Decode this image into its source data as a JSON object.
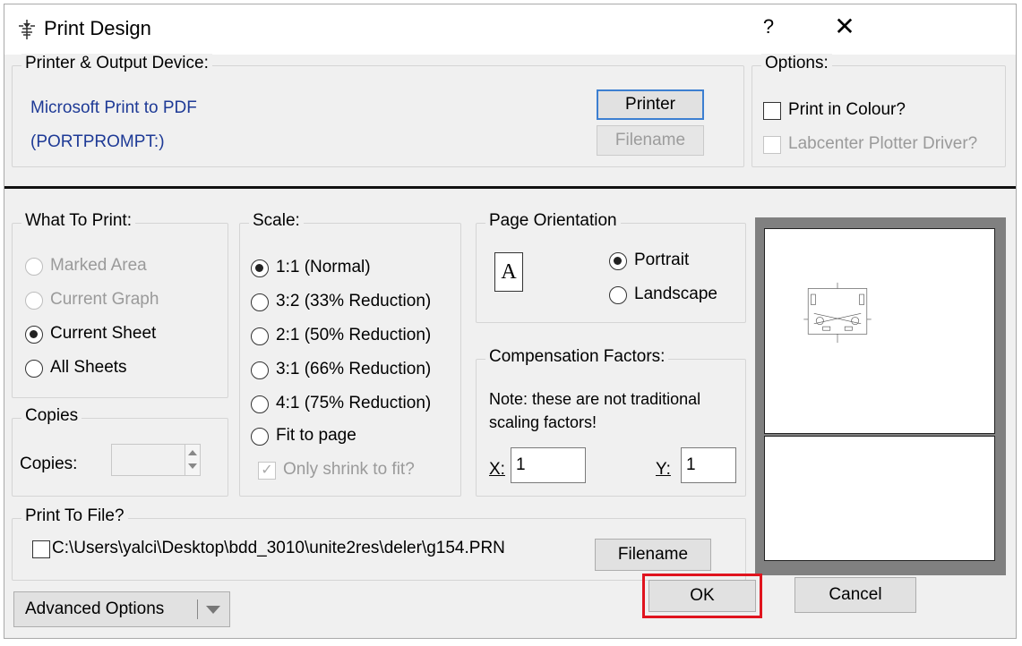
{
  "window": {
    "title": "Print Design",
    "help": "?",
    "close": "✕"
  },
  "printer": {
    "legend": "Printer & Output Device:",
    "device": "Microsoft Print to PDF",
    "port": "(PORTPROMPT:)",
    "printer_btn": "Printer",
    "filename_btn": "Filename"
  },
  "options": {
    "legend": "Options:",
    "print_colour": "Print in Colour?",
    "plotter_driver": "Labcenter Plotter Driver?"
  },
  "what_to_print": {
    "legend": "What To Print:",
    "items": [
      "Marked Area",
      "Current Graph",
      "Current Sheet",
      "All Sheets"
    ],
    "selected": "Current Sheet"
  },
  "scale": {
    "legend": "Scale:",
    "items": [
      "1:1 (Normal)",
      "3:2 (33% Reduction)",
      "2:1 (50% Reduction)",
      "3:1 (66% Reduction)",
      "4:1 (75% Reduction)",
      "Fit to page"
    ],
    "selected": "1:1 (Normal)",
    "shrink_label": "Only shrink to fit?"
  },
  "orientation": {
    "legend": "Page Orientation",
    "portrait": "Portrait",
    "landscape": "Landscape",
    "selected": "Portrait",
    "page_glyph": "A"
  },
  "compensation": {
    "legend": "Compensation Factors:",
    "note_line1": "Note: these are not traditional",
    "note_line2": "scaling factors!",
    "x_label": "X:",
    "x_value": "1",
    "y_label": "Y:",
    "y_value": "1"
  },
  "copies": {
    "legend": "Copies",
    "label": "Copies:",
    "value": ""
  },
  "print_to_file": {
    "legend": "Print To File?",
    "path": "C:\\Users\\yalci\\Desktop\\bdd_3010\\unite2res\\deler\\g154.PRN",
    "filename_btn": "Filename"
  },
  "footer": {
    "advanced": "Advanced Options",
    "ok": "OK",
    "cancel": "Cancel"
  },
  "colors": {
    "accent": "#3c7fd1",
    "highlight": "#e0141e",
    "link": "#1e3a96"
  }
}
